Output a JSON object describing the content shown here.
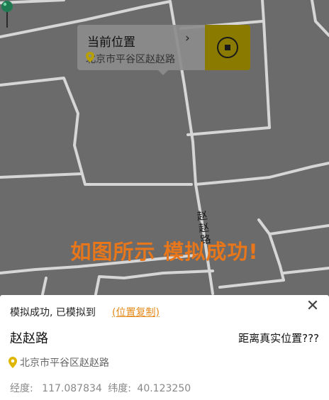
{
  "map": {
    "road_label": "赵赵路",
    "overlay_caption": "如图所示 模拟成功!",
    "popup": {
      "title": "当前位置",
      "chevron": "›",
      "address": "北京市平谷区赵赵路",
      "stop_icon": "stop-circle-icon"
    }
  },
  "sheet": {
    "status": "模拟成功, 已模拟到",
    "copy_link": "(位置复制)",
    "close": "✕",
    "road_name": "赵赵路",
    "distance_prompt": "距离真实位置???",
    "address": "北京市平谷区赵赵路",
    "longitude_label": "经度:",
    "longitude_value": "117.087834",
    "latitude_label": "纬度:",
    "latitude_value": "40.123250"
  },
  "colors": {
    "map_bg": "#6b6b6b",
    "roads": "#cfcfcf",
    "accent_orange": "#e8761a",
    "pin_green": "#1f8a5a",
    "pin_yellow": "#e0b700",
    "stop_button": "#8a7a00"
  }
}
